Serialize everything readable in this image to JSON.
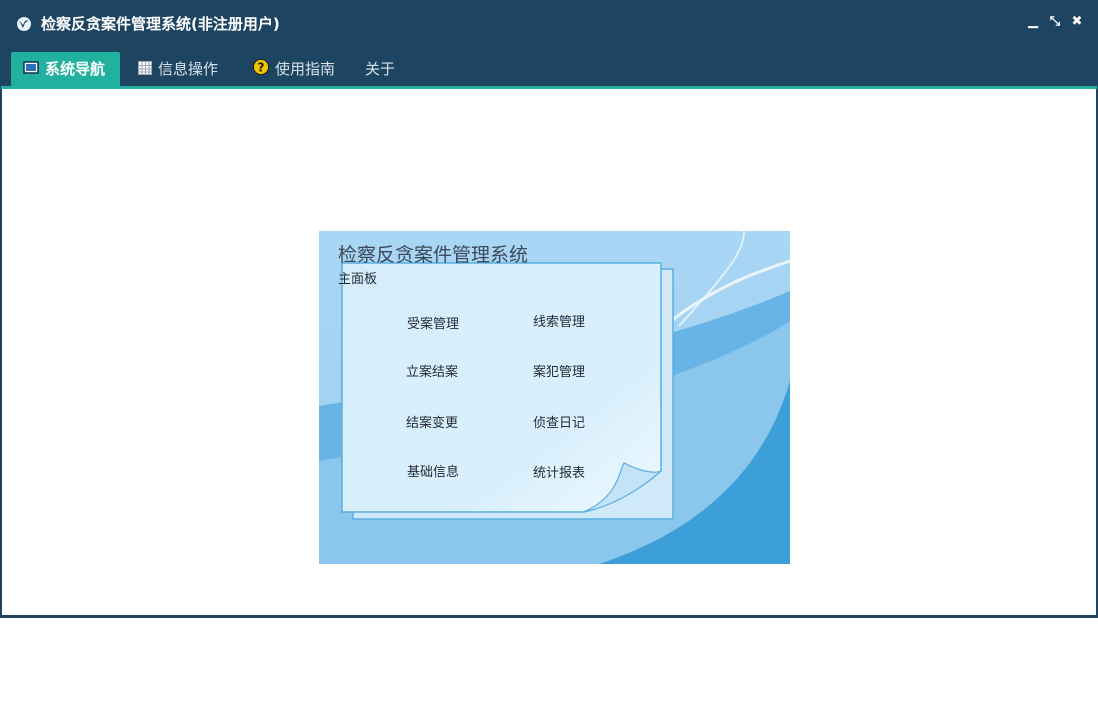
{
  "window": {
    "title": "检察反贪案件管理系统(非注册用户)",
    "controls": {
      "minimize": "▁",
      "restore": "⤡",
      "close": "✖"
    }
  },
  "menu": {
    "tabs": [
      {
        "label": "系统导航",
        "icon": "monitor-icon",
        "active": true
      },
      {
        "label": "信息操作",
        "icon": "grid-icon",
        "active": false
      },
      {
        "label": "使用指南",
        "icon": "help-icon",
        "active": false
      },
      {
        "label": "关于",
        "icon": "",
        "active": false
      }
    ]
  },
  "panel": {
    "title": "检察反贪案件管理系统",
    "subtitle": "主面板",
    "items": [
      {
        "label": "受案管理"
      },
      {
        "label": "线索管理"
      },
      {
        "label": "立案结案"
      },
      {
        "label": "案犯管理"
      },
      {
        "label": "结案变更"
      },
      {
        "label": "侦查日记"
      },
      {
        "label": "基础信息"
      },
      {
        "label": "统计报表"
      }
    ]
  },
  "colors": {
    "titlebar": "#1d4562",
    "accent": "#22b19e",
    "panel_sky": "#a6d3f2",
    "panel_blue": "#3d9fd8",
    "sheet": "#dcf0fb"
  }
}
